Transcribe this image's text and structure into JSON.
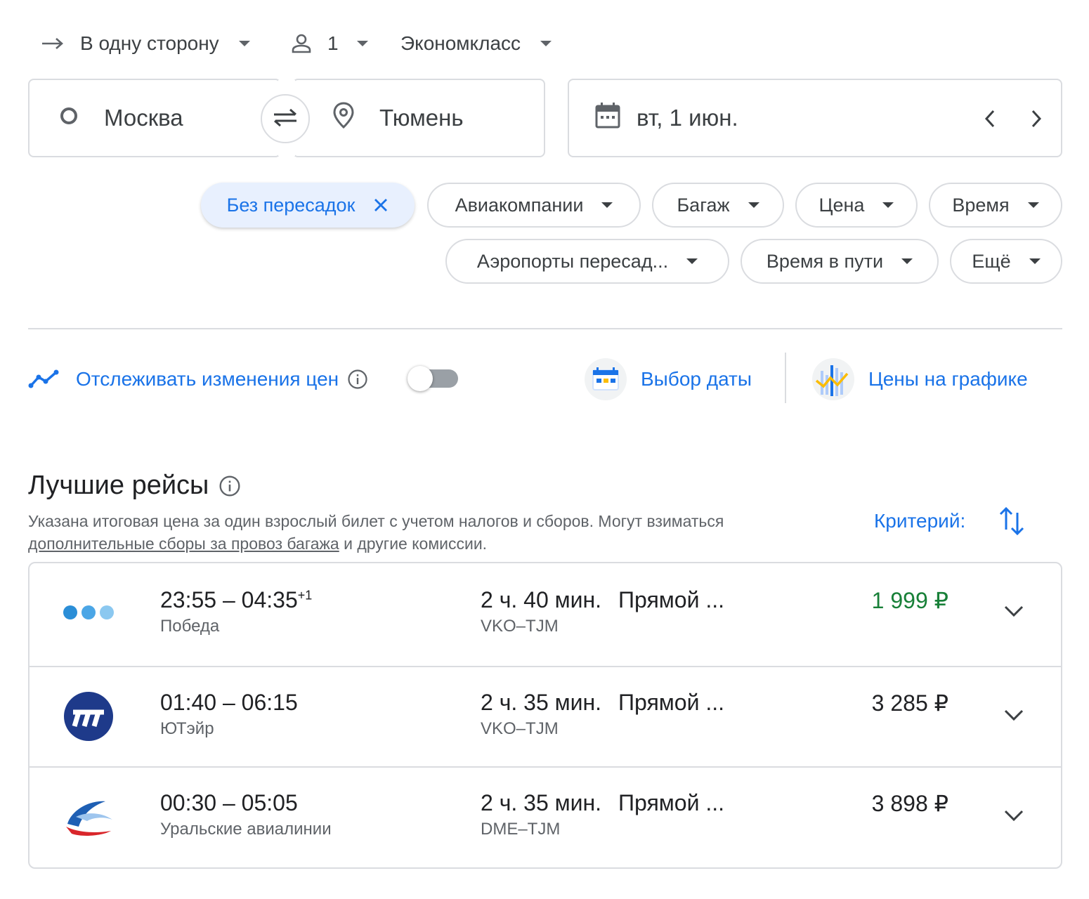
{
  "trip_type": "В одну сторону",
  "passengers": "1",
  "cabin_class": "Экономкласс",
  "origin": "Москва",
  "destination": "Тюмень",
  "date": "вт, 1 июн.",
  "filters": {
    "nonstop": "Без пересадок",
    "airlines": "Авиакомпании",
    "baggage": "Багаж",
    "price": "Цена",
    "time": "Время",
    "layover_airports": "Аэропорты пересад...",
    "duration": "Время в пути",
    "more": "Ещё"
  },
  "track_prices": "Отслеживать изменения цен",
  "date_grid": "Выбор даты",
  "price_graph": "Цены на графике",
  "best_flights": {
    "title": "Лучшие рейсы",
    "note_before": "Указана итоговая цена за один взрослый билет с учетом налогов и сборов. Могут взиматься ",
    "note_link": "дополнительные сборы за провоз багажа",
    "note_after": " и другие комиссии.",
    "sort_label": "Критерий:"
  },
  "flights": [
    {
      "times": "23:55 – 04:35",
      "day_offset": "+1",
      "airline": "Победа",
      "duration": "2 ч. 40 мин.",
      "route": "VKO–TJM",
      "stops": "Прямой ...",
      "price": "1 999 ₽",
      "price_color": "#188038"
    },
    {
      "times": "01:40 – 06:15",
      "day_offset": "",
      "airline": "ЮТэйр",
      "duration": "2 ч. 35 мин.",
      "route": "VKO–TJM",
      "stops": "Прямой ...",
      "price": "3 285 ₽",
      "price_color": "#202124"
    },
    {
      "times": "00:30 – 05:05",
      "day_offset": "",
      "airline": "Уральские авиалинии",
      "duration": "2 ч. 35 мин.",
      "route": "DME–TJM",
      "stops": "Прямой ...",
      "price": "3 898 ₽",
      "price_color": "#202124"
    }
  ],
  "colors": {
    "accent": "#1a73e8",
    "chip_active_bg": "#e8f0fe",
    "border": "#dadce0"
  }
}
